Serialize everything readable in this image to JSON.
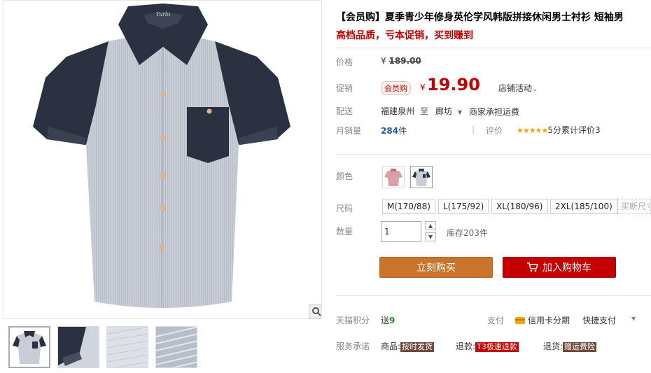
{
  "product": {
    "title": "【会员购】夏季青少年修身英伦学风韩版拼接休闲男士衬衫 短袖男",
    "subtitle": "高档品质，亏本促销，买到赚到"
  },
  "price": {
    "label": "价格",
    "currency": "¥",
    "original": "189.00",
    "promo_label": "促销",
    "member_badge": "会员购",
    "promo_price": "19.90",
    "shop_activity": "店铺活动"
  },
  "shipping": {
    "label": "配送",
    "from": "福建泉州",
    "to_word": "至",
    "to": "廊坊",
    "fee": "商家承担运费"
  },
  "sales": {
    "label": "月销量",
    "count": "284",
    "unit": "件",
    "review_label": "评价",
    "stars": "★★★★★",
    "rating_text": "5分累计评价3"
  },
  "color": {
    "label": "颜色"
  },
  "size": {
    "label": "尺码",
    "options": [
      "M(170/88)",
      "L(175/92)",
      "XL(180/96)",
      "2XL(185/100)",
      "买断尺寸"
    ]
  },
  "quantity": {
    "label": "数量",
    "value": "1",
    "stock": "库存203件"
  },
  "actions": {
    "buy_now": "立刻购买",
    "add_to_cart": "加入购物车"
  },
  "points": {
    "label": "天猫积分",
    "value_prefix": "送",
    "value": "9",
    "pay_label": "支付",
    "credit": "信用卡分期",
    "quick_pay": "快捷支付"
  },
  "service": {
    "label": "服务承诺",
    "goods_label": "商品:",
    "goods_tag": "按时发货",
    "refund_label": "退款:",
    "refund_tag": "T3极速退款",
    "return_label": "退货:",
    "return_tag": "赠运费险"
  },
  "colors": {
    "accent_red": "#c40000",
    "buy_orange": "#c9742a",
    "shirt_body": "#c9ced6",
    "shirt_dark": "#2b3140"
  }
}
